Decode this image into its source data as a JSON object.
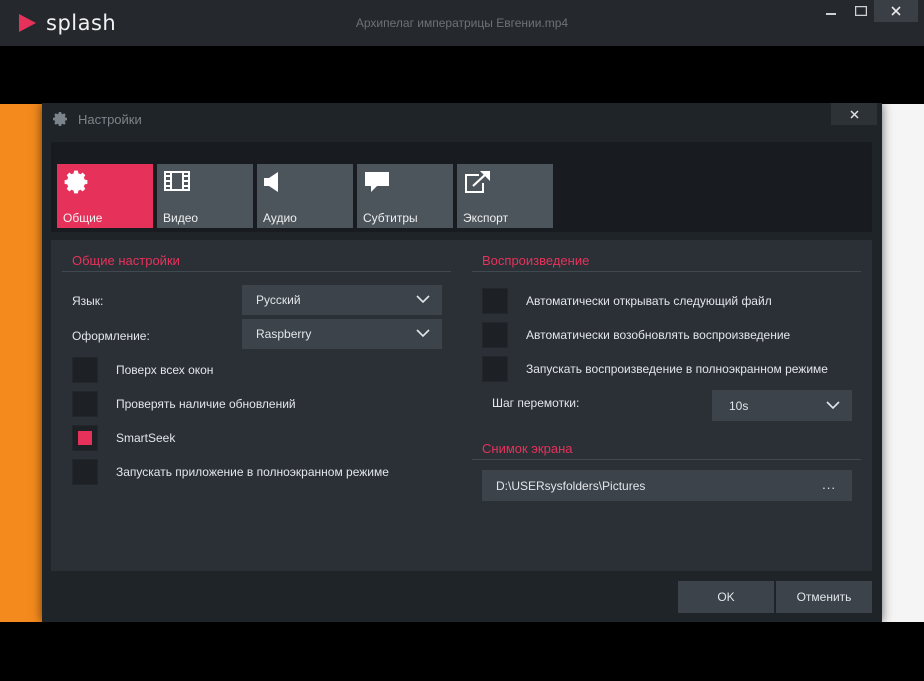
{
  "app": {
    "logo_text": "splash",
    "window_title": "Архипелаг императрицы Евгении.mp4"
  },
  "colors": {
    "accent": "#e6325b",
    "panel": "#2b3036",
    "tab": "#4c545c"
  },
  "dialog": {
    "title": "Настройки",
    "tabs": [
      {
        "label": "Общие",
        "icon": "gear-icon",
        "active": true
      },
      {
        "label": "Видео",
        "icon": "film-icon",
        "active": false
      },
      {
        "label": "Аудио",
        "icon": "speaker-icon",
        "active": false
      },
      {
        "label": "Субтитры",
        "icon": "speech-bubble-icon",
        "active": false
      },
      {
        "label": "Экспорт",
        "icon": "export-icon",
        "active": false
      }
    ],
    "general": {
      "title": "Общие настройки",
      "language_label": "Язык:",
      "language_value": "Русский",
      "theme_label": "Оформление:",
      "theme_value": "Raspberry",
      "checkboxes": [
        {
          "label": "Поверх всех окон",
          "checked": false
        },
        {
          "label": "Проверять наличие обновлений",
          "checked": false
        },
        {
          "label": "SmartSeek",
          "checked": true
        },
        {
          "label": "Запускать приложение в полноэкранном режиме",
          "checked": false
        }
      ]
    },
    "playback": {
      "title": "Воспроизведение",
      "checkboxes": [
        {
          "label": "Автоматически открывать следующий файл",
          "checked": false
        },
        {
          "label": "Автоматически возобновлять воспроизведение",
          "checked": false
        },
        {
          "label": "Запускать воспроизведение в полноэкранном режиме",
          "checked": false
        }
      ],
      "seek_label": "Шаг перемотки:",
      "seek_value": "10s"
    },
    "screenshot": {
      "title": "Снимок экрана",
      "path": "D:\\USERsysfolders\\Pictures",
      "browse": "..."
    },
    "buttons": {
      "ok": "OK",
      "cancel": "Отменить"
    }
  }
}
